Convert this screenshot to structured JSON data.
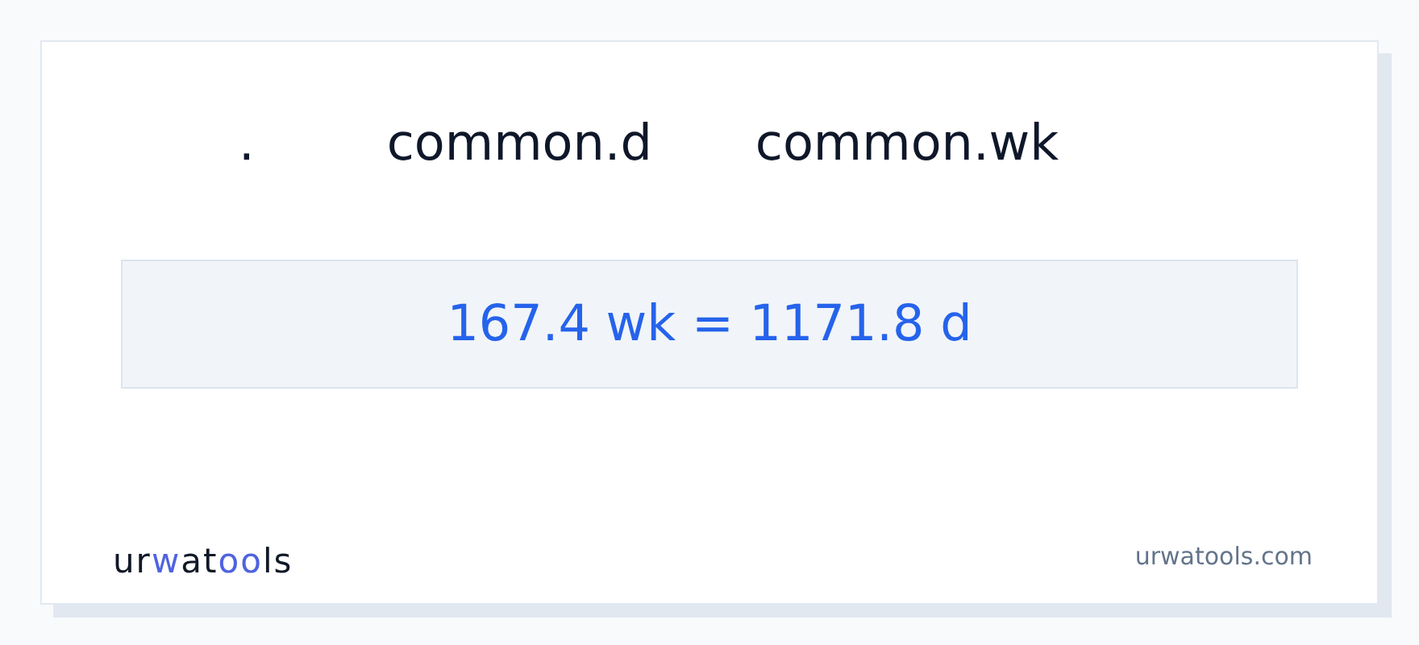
{
  "headers": [
    ".",
    "common.d",
    "common.wk"
  ],
  "result": "167.4 wk = 1171.8 d",
  "logo": [
    {
      "text": "ur",
      "accent": false
    },
    {
      "text": "w",
      "accent": true
    },
    {
      "text": "at",
      "accent": false
    },
    {
      "text": "oo",
      "accent": true
    },
    {
      "text": "ls",
      "accent": false
    }
  ],
  "site": "urwatools.com"
}
